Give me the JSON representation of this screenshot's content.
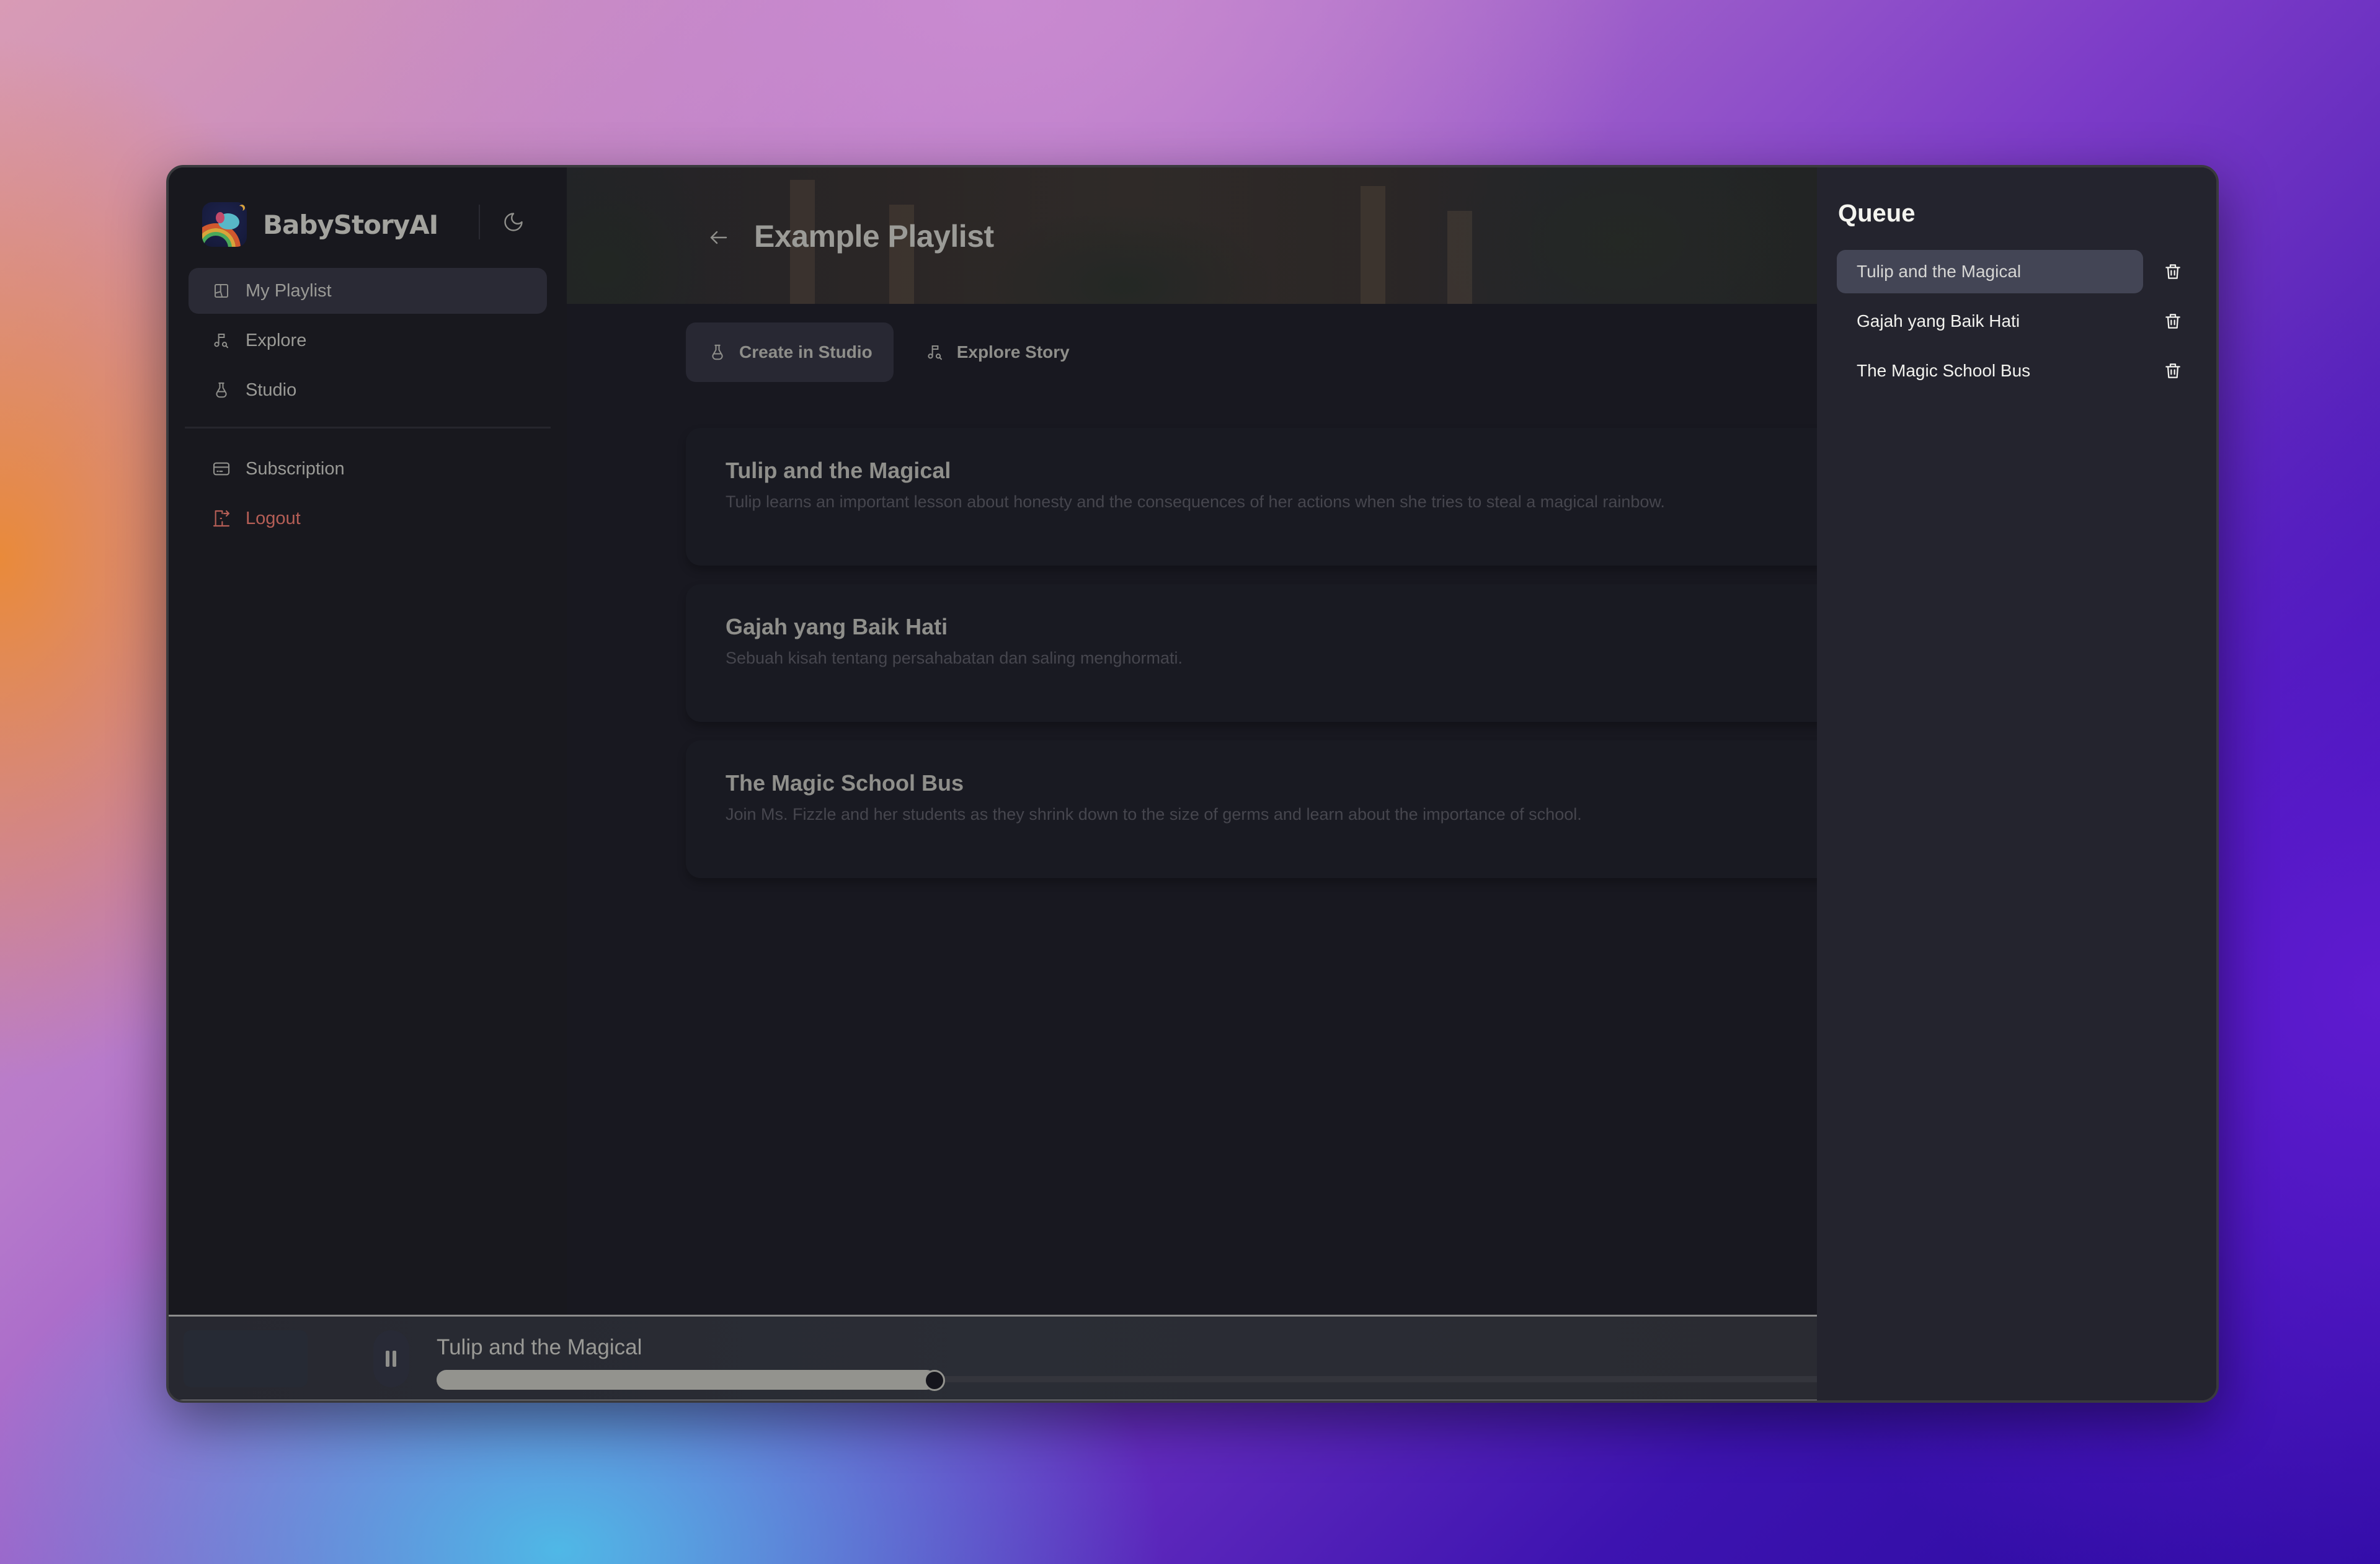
{
  "app": {
    "brand_name": "BabyStoryAI",
    "logo_icon": "elephant-rainbow-logo",
    "theme_toggle_icon": "moon-icon"
  },
  "sidebar": {
    "items": [
      {
        "label": "My Playlist",
        "icon": "playlist-layout-icon",
        "active": true
      },
      {
        "label": "Explore",
        "icon": "music-search-icon",
        "active": false
      },
      {
        "label": "Studio",
        "icon": "flask-icon",
        "active": false
      }
    ],
    "secondary_items": [
      {
        "label": "Subscription",
        "icon": "credit-card-icon"
      },
      {
        "label": "Logout",
        "icon": "logout-door-icon",
        "color": "#b55e56"
      }
    ]
  },
  "header": {
    "back_icon": "arrow-left-icon",
    "title": "Example Playlist"
  },
  "actions": {
    "create_label": "Create in Studio",
    "explore_label": "Explore Story"
  },
  "stories": [
    {
      "title": "Tulip and the Magical",
      "description": "Tulip learns an important lesson about honesty and the consequences of her actions when she tries to steal a magical rainbow."
    },
    {
      "title": "Gajah yang Baik Hati",
      "description": "Sebuah kisah tentang persahabatan dan saling menghormati."
    },
    {
      "title": "The Magic School Bus",
      "description": "Join Ms. Fizzle and her students as they shrink down to the size of germs and learn about the importance of school."
    }
  ],
  "player": {
    "now_playing_title": "Tulip and the Magical",
    "state": "playing",
    "control_icon": "pause-icon",
    "progress_fraction": 0.36
  },
  "queue": {
    "title": "Queue",
    "items": [
      {
        "title": "Tulip and the Magical",
        "active": true
      },
      {
        "title": "Gajah yang Baik Hati",
        "active": false
      },
      {
        "title": "The Magic School Bus",
        "active": false
      }
    ],
    "delete_icon": "trash-icon"
  },
  "colors": {
    "accent_danger": "#b55e56",
    "active_queue_bg": "#434555",
    "progress_fill": "#93938e"
  }
}
